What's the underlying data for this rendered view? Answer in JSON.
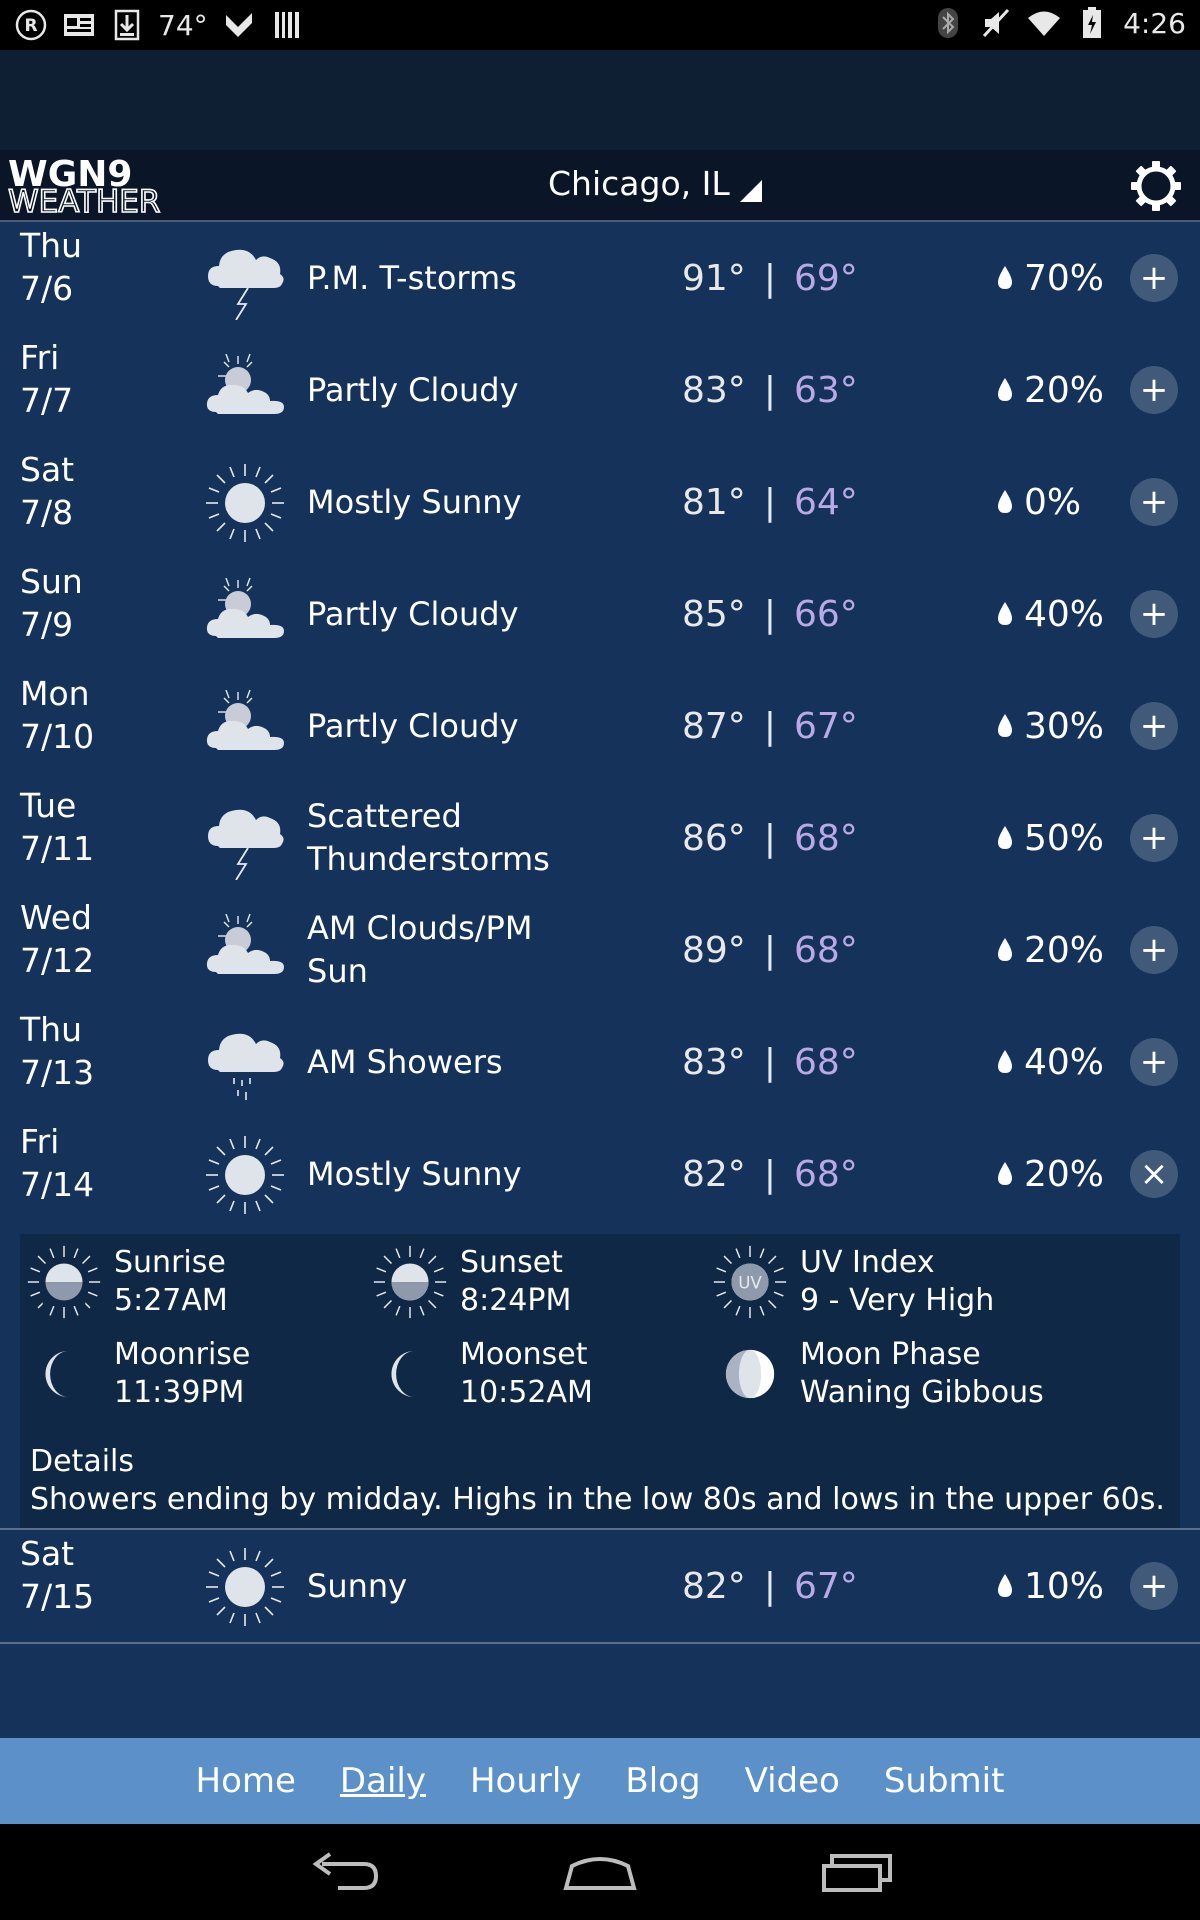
{
  "status_bar": {
    "temperature": "74°",
    "time": "4:26"
  },
  "header": {
    "logo_top": "WGN9",
    "logo_bottom": "WEATHER",
    "location": "Chicago, IL"
  },
  "days": [
    {
      "dow": "Thu",
      "date": "7/6",
      "icon": "thunderstorm-icon",
      "condition": "P.M. T-storms",
      "high": "91°",
      "low": "69°",
      "precip": "70%",
      "toggle": "+"
    },
    {
      "dow": "Fri",
      "date": "7/7",
      "icon": "partly-cloudy-icon",
      "condition": "Partly Cloudy",
      "high": "83°",
      "low": "63°",
      "precip": "20%",
      "toggle": "+"
    },
    {
      "dow": "Sat",
      "date": "7/8",
      "icon": "sunny-icon",
      "condition": "Mostly Sunny",
      "high": "81°",
      "low": "64°",
      "precip": "0%",
      "toggle": "+"
    },
    {
      "dow": "Sun",
      "date": "7/9",
      "icon": "partly-cloudy-icon",
      "condition": "Partly Cloudy",
      "high": "85°",
      "low": "66°",
      "precip": "40%",
      "toggle": "+"
    },
    {
      "dow": "Mon",
      "date": "7/10",
      "icon": "partly-cloudy-icon",
      "condition": "Partly Cloudy",
      "high": "87°",
      "low": "67°",
      "precip": "30%",
      "toggle": "+"
    },
    {
      "dow": "Tue",
      "date": "7/11",
      "icon": "thunderstorm-icon",
      "condition_line1": "Scattered",
      "condition_line2": "Thunderstorms",
      "high": "86°",
      "low": "68°",
      "precip": "50%",
      "toggle": "+"
    },
    {
      "dow": "Wed",
      "date": "7/12",
      "icon": "partly-cloudy-icon",
      "condition_line1": "AM Clouds/PM",
      "condition_line2": "Sun",
      "high": "89°",
      "low": "68°",
      "precip": "20%",
      "toggle": "+"
    },
    {
      "dow": "Thu",
      "date": "7/13",
      "icon": "showers-icon",
      "condition": "AM Showers",
      "high": "83°",
      "low": "68°",
      "precip": "40%",
      "toggle": "+"
    },
    {
      "dow": "Fri",
      "date": "7/14",
      "icon": "sunny-icon",
      "condition": "Mostly Sunny",
      "high": "82°",
      "low": "68°",
      "precip": "20%",
      "toggle": "×"
    },
    {
      "dow": "Sat",
      "date": "7/15",
      "icon": "sunny-icon",
      "condition": "Sunny",
      "high": "82°",
      "low": "67°",
      "precip": "10%",
      "toggle": "+"
    }
  ],
  "expanded": {
    "sunrise_label": "Sunrise",
    "sunrise_value": "5:27AM",
    "sunset_label": "Sunset",
    "sunset_value": "8:24PM",
    "uv_label": "UV Index",
    "uv_value": "9 - Very High",
    "uv_badge": "UV",
    "moonrise_label": "Moonrise",
    "moonrise_value": "11:39PM",
    "moonset_label": "Moonset",
    "moonset_value": "10:52AM",
    "moonphase_label": "Moon Phase",
    "moonphase_value": "Waning Gibbous",
    "details_label": "Details",
    "details_text": "Showers ending by midday. Highs in the low 80s and lows in the upper 60s."
  },
  "nav": {
    "home": "Home",
    "daily": "Daily",
    "hourly": "Hourly",
    "blog": "Blog",
    "video": "Video",
    "submit": "Submit",
    "active": "Daily"
  }
}
